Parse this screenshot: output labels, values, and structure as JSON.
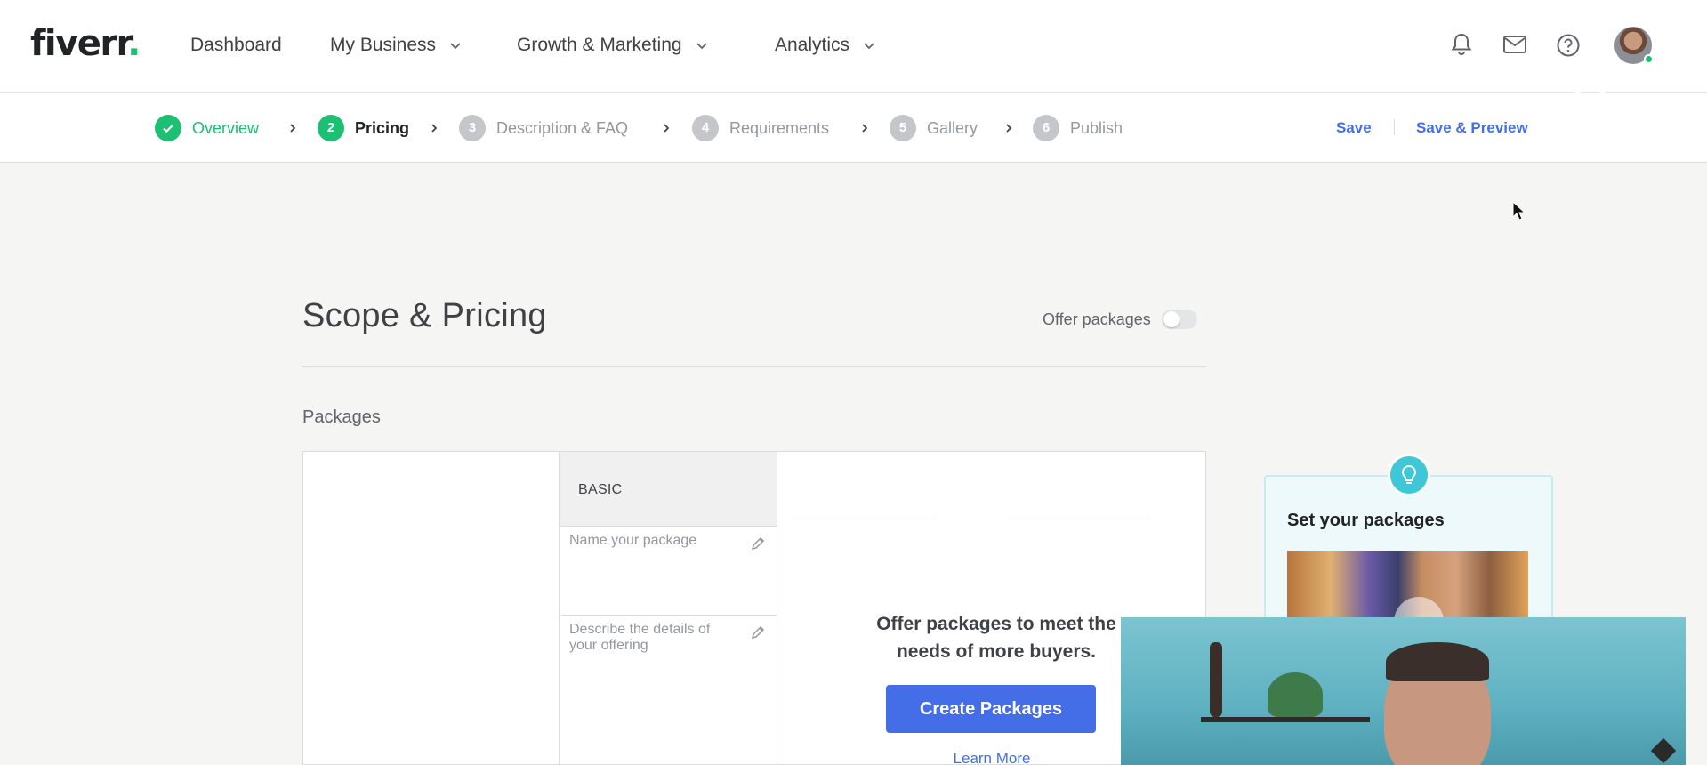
{
  "brand": {
    "logo_text": "fiverr",
    "logo_dot": ".",
    "accent": "#1dbf73",
    "link_color": "#446ee7"
  },
  "nav": {
    "items": [
      {
        "label": "Dashboard",
        "has_dropdown": false
      },
      {
        "label": "My Business",
        "has_dropdown": true
      },
      {
        "label": "Growth & Marketing",
        "has_dropdown": true
      },
      {
        "label": "Analytics",
        "has_dropdown": true
      }
    ],
    "icons": [
      "bell-icon",
      "mail-icon",
      "help-icon",
      "avatar"
    ]
  },
  "steps": [
    {
      "number": "1",
      "label": "Overview",
      "state": "done"
    },
    {
      "number": "2",
      "label": "Pricing",
      "state": "active"
    },
    {
      "number": "3",
      "label": "Description & FAQ",
      "state": "pending"
    },
    {
      "number": "4",
      "label": "Requirements",
      "state": "pending"
    },
    {
      "number": "5",
      "label": "Gallery",
      "state": "pending"
    },
    {
      "number": "6",
      "label": "Publish",
      "state": "pending"
    }
  ],
  "actions": {
    "save": "Save",
    "save_preview": "Save & Preview"
  },
  "page": {
    "title": "Scope & Pricing",
    "offer_packages_label": "Offer packages",
    "offer_packages_enabled": false,
    "packages_label": "Packages"
  },
  "table": {
    "basic_header": "BASIC",
    "name_placeholder": "Name your package",
    "describe_placeholder": "Describe the details of your offering",
    "overlay_text": "Offer packages to meet the needs of more buyers.",
    "create_button": "Create Packages",
    "learn_more": "Learn More"
  },
  "tip": {
    "title": "Set your packages"
  }
}
